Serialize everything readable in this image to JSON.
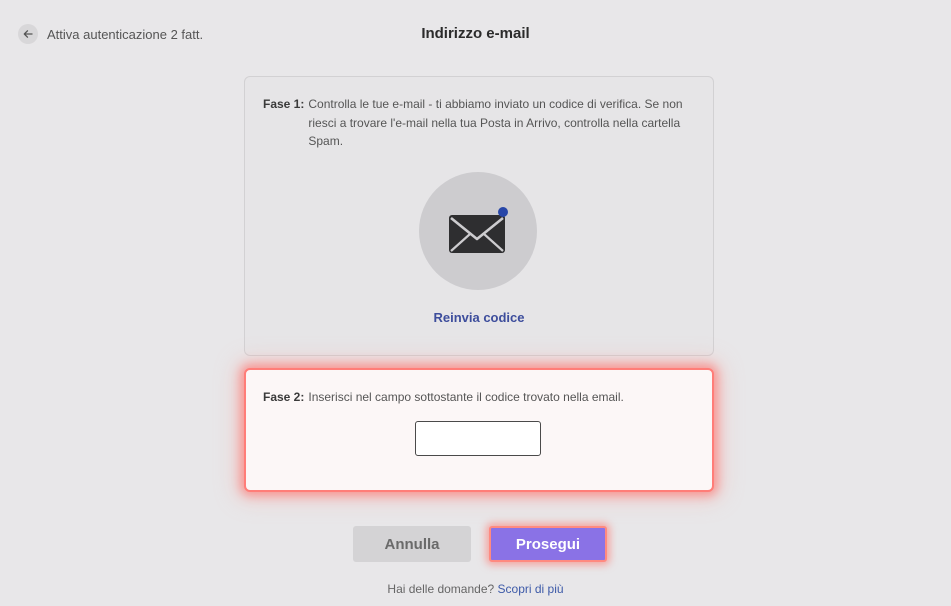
{
  "header": {
    "back_label": "Attiva autenticazione 2 fatt.",
    "title": "Indirizzo e-mail"
  },
  "step1": {
    "label": "Fase 1:",
    "text": "Controlla le tue e-mail - ti abbiamo inviato un codice di verifica. Se non riesci a trovare l'e-mail nella tua Posta in Arrivo, controlla nella cartella Spam.",
    "resend_label": "Reinvia codice"
  },
  "step2": {
    "label": "Fase 2:",
    "text": "Inserisci nel campo sottostante il codice trovato nella email.",
    "code_value": ""
  },
  "actions": {
    "cancel_label": "Annulla",
    "continue_label": "Prosegui"
  },
  "footer": {
    "question": "Hai delle domande?",
    "link": "Scopri di più"
  },
  "icons": {
    "back": "arrow-left-icon",
    "mail": "envelope-icon",
    "notification": "notification-dot-icon"
  },
  "colors": {
    "accent": "#8a72e6",
    "link": "#3d4d9c",
    "highlight": "#ff7d78",
    "notification_dot": "#2746a8"
  }
}
